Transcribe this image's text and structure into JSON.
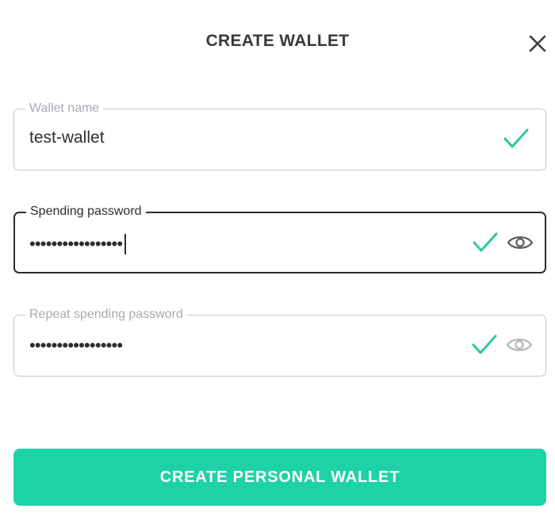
{
  "dialog": {
    "title": "CREATE WALLET",
    "close_icon": "close-icon"
  },
  "fields": {
    "wallet_name": {
      "label": "Wallet name",
      "value": "test-wallet",
      "valid": true,
      "status_icon": "checkmark-icon"
    },
    "spending_password": {
      "label": "Spending password",
      "masked_value": "•••••••••••••••••",
      "focused": true,
      "valid": true,
      "status_icon": "checkmark-icon",
      "toggle_icon": "eye-icon"
    },
    "repeat_password": {
      "label": "Repeat spending password",
      "masked_value": "•••••••••••••••••",
      "valid": true,
      "status_icon": "checkmark-icon",
      "toggle_icon": "eye-icon"
    }
  },
  "submit_button": {
    "label": "CREATE PERSONAL WALLET"
  },
  "colors": {
    "accent": "#1ed2a8",
    "check": "#2bc8a0",
    "text": "#38393b",
    "border": "#c3c6cc",
    "border_focused": "#2b2d30",
    "placeholder": "#a6aab1"
  }
}
